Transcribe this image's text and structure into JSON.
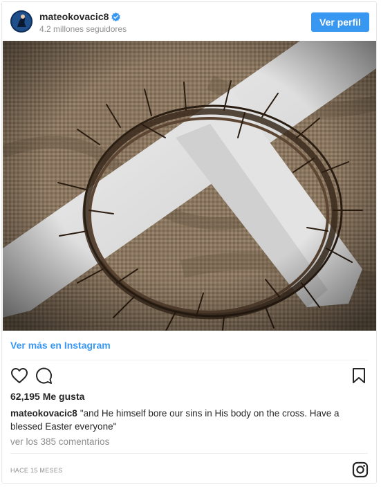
{
  "header": {
    "username": "mateokovacic8",
    "verified": true,
    "followers": "4.2 millones seguidores",
    "view_profile_label": "Ver perfil"
  },
  "post": {
    "image_description_icon": "crown-of-thorns-cross-image",
    "more_link": "Ver más en Instagram",
    "likes": "62,195 Me gusta",
    "caption_user": "mateokovacic8",
    "caption_text": "\"and He himself bore our sins in His body on the cross. Have a blessed Easter everyone\"",
    "comments_link": "ver los 385 comentarios",
    "timestamp": "HACE 15 MESES"
  },
  "icons": {
    "like": "heart-icon",
    "comment": "comment-icon",
    "save": "bookmark-icon",
    "brand": "instagram-icon",
    "verified": "verified-badge-icon"
  },
  "colors": {
    "accent": "#3897f0",
    "text": "#262626",
    "muted": "#8e8e8e",
    "border": "#e6e6e6"
  }
}
